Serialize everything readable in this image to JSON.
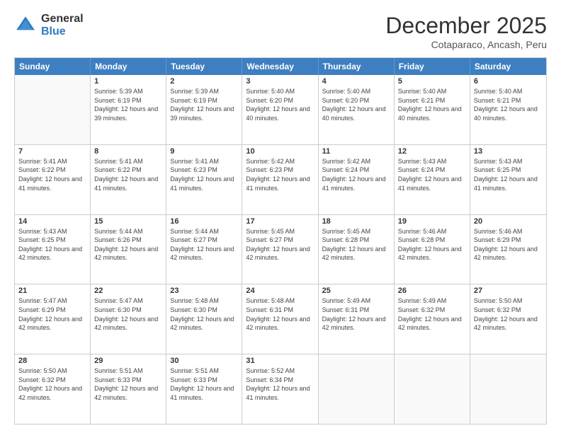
{
  "logo": {
    "general": "General",
    "blue": "Blue"
  },
  "header": {
    "month": "December 2025",
    "location": "Cotaparaco, Ancash, Peru"
  },
  "days_of_week": [
    "Sunday",
    "Monday",
    "Tuesday",
    "Wednesday",
    "Thursday",
    "Friday",
    "Saturday"
  ],
  "weeks": [
    [
      {
        "day": "",
        "empty": true
      },
      {
        "day": "1",
        "sunrise": "Sunrise: 5:39 AM",
        "sunset": "Sunset: 6:19 PM",
        "daylight": "Daylight: 12 hours and 39 minutes."
      },
      {
        "day": "2",
        "sunrise": "Sunrise: 5:39 AM",
        "sunset": "Sunset: 6:19 PM",
        "daylight": "Daylight: 12 hours and 39 minutes."
      },
      {
        "day": "3",
        "sunrise": "Sunrise: 5:40 AM",
        "sunset": "Sunset: 6:20 PM",
        "daylight": "Daylight: 12 hours and 40 minutes."
      },
      {
        "day": "4",
        "sunrise": "Sunrise: 5:40 AM",
        "sunset": "Sunset: 6:20 PM",
        "daylight": "Daylight: 12 hours and 40 minutes."
      },
      {
        "day": "5",
        "sunrise": "Sunrise: 5:40 AM",
        "sunset": "Sunset: 6:21 PM",
        "daylight": "Daylight: 12 hours and 40 minutes."
      },
      {
        "day": "6",
        "sunrise": "Sunrise: 5:40 AM",
        "sunset": "Sunset: 6:21 PM",
        "daylight": "Daylight: 12 hours and 40 minutes."
      }
    ],
    [
      {
        "day": "7",
        "sunrise": "Sunrise: 5:41 AM",
        "sunset": "Sunset: 6:22 PM",
        "daylight": "Daylight: 12 hours and 41 minutes."
      },
      {
        "day": "8",
        "sunrise": "Sunrise: 5:41 AM",
        "sunset": "Sunset: 6:22 PM",
        "daylight": "Daylight: 12 hours and 41 minutes."
      },
      {
        "day": "9",
        "sunrise": "Sunrise: 5:41 AM",
        "sunset": "Sunset: 6:23 PM",
        "daylight": "Daylight: 12 hours and 41 minutes."
      },
      {
        "day": "10",
        "sunrise": "Sunrise: 5:42 AM",
        "sunset": "Sunset: 6:23 PM",
        "daylight": "Daylight: 12 hours and 41 minutes."
      },
      {
        "day": "11",
        "sunrise": "Sunrise: 5:42 AM",
        "sunset": "Sunset: 6:24 PM",
        "daylight": "Daylight: 12 hours and 41 minutes."
      },
      {
        "day": "12",
        "sunrise": "Sunrise: 5:43 AM",
        "sunset": "Sunset: 6:24 PM",
        "daylight": "Daylight: 12 hours and 41 minutes."
      },
      {
        "day": "13",
        "sunrise": "Sunrise: 5:43 AM",
        "sunset": "Sunset: 6:25 PM",
        "daylight": "Daylight: 12 hours and 41 minutes."
      }
    ],
    [
      {
        "day": "14",
        "sunrise": "Sunrise: 5:43 AM",
        "sunset": "Sunset: 6:25 PM",
        "daylight": "Daylight: 12 hours and 42 minutes."
      },
      {
        "day": "15",
        "sunrise": "Sunrise: 5:44 AM",
        "sunset": "Sunset: 6:26 PM",
        "daylight": "Daylight: 12 hours and 42 minutes."
      },
      {
        "day": "16",
        "sunrise": "Sunrise: 5:44 AM",
        "sunset": "Sunset: 6:27 PM",
        "daylight": "Daylight: 12 hours and 42 minutes."
      },
      {
        "day": "17",
        "sunrise": "Sunrise: 5:45 AM",
        "sunset": "Sunset: 6:27 PM",
        "daylight": "Daylight: 12 hours and 42 minutes."
      },
      {
        "day": "18",
        "sunrise": "Sunrise: 5:45 AM",
        "sunset": "Sunset: 6:28 PM",
        "daylight": "Daylight: 12 hours and 42 minutes."
      },
      {
        "day": "19",
        "sunrise": "Sunrise: 5:46 AM",
        "sunset": "Sunset: 6:28 PM",
        "daylight": "Daylight: 12 hours and 42 minutes."
      },
      {
        "day": "20",
        "sunrise": "Sunrise: 5:46 AM",
        "sunset": "Sunset: 6:29 PM",
        "daylight": "Daylight: 12 hours and 42 minutes."
      }
    ],
    [
      {
        "day": "21",
        "sunrise": "Sunrise: 5:47 AM",
        "sunset": "Sunset: 6:29 PM",
        "daylight": "Daylight: 12 hours and 42 minutes."
      },
      {
        "day": "22",
        "sunrise": "Sunrise: 5:47 AM",
        "sunset": "Sunset: 6:30 PM",
        "daylight": "Daylight: 12 hours and 42 minutes."
      },
      {
        "day": "23",
        "sunrise": "Sunrise: 5:48 AM",
        "sunset": "Sunset: 6:30 PM",
        "daylight": "Daylight: 12 hours and 42 minutes."
      },
      {
        "day": "24",
        "sunrise": "Sunrise: 5:48 AM",
        "sunset": "Sunset: 6:31 PM",
        "daylight": "Daylight: 12 hours and 42 minutes."
      },
      {
        "day": "25",
        "sunrise": "Sunrise: 5:49 AM",
        "sunset": "Sunset: 6:31 PM",
        "daylight": "Daylight: 12 hours and 42 minutes."
      },
      {
        "day": "26",
        "sunrise": "Sunrise: 5:49 AM",
        "sunset": "Sunset: 6:32 PM",
        "daylight": "Daylight: 12 hours and 42 minutes."
      },
      {
        "day": "27",
        "sunrise": "Sunrise: 5:50 AM",
        "sunset": "Sunset: 6:32 PM",
        "daylight": "Daylight: 12 hours and 42 minutes."
      }
    ],
    [
      {
        "day": "28",
        "sunrise": "Sunrise: 5:50 AM",
        "sunset": "Sunset: 6:32 PM",
        "daylight": "Daylight: 12 hours and 42 minutes."
      },
      {
        "day": "29",
        "sunrise": "Sunrise: 5:51 AM",
        "sunset": "Sunset: 6:33 PM",
        "daylight": "Daylight: 12 hours and 42 minutes."
      },
      {
        "day": "30",
        "sunrise": "Sunrise: 5:51 AM",
        "sunset": "Sunset: 6:33 PM",
        "daylight": "Daylight: 12 hours and 41 minutes."
      },
      {
        "day": "31",
        "sunrise": "Sunrise: 5:52 AM",
        "sunset": "Sunset: 6:34 PM",
        "daylight": "Daylight: 12 hours and 41 minutes."
      },
      {
        "day": "",
        "empty": true
      },
      {
        "day": "",
        "empty": true
      },
      {
        "day": "",
        "empty": true
      }
    ]
  ]
}
